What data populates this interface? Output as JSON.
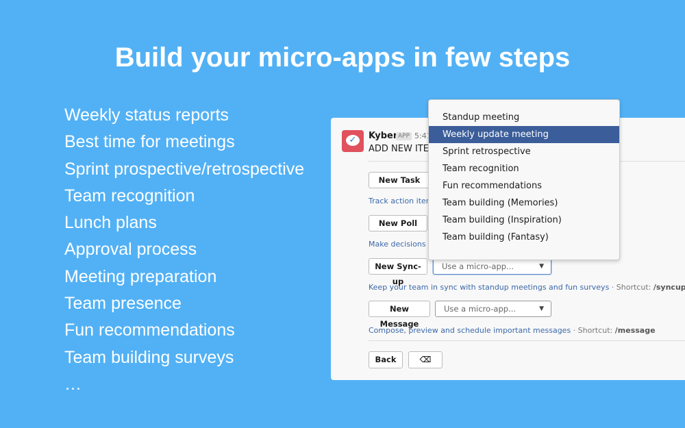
{
  "title": "Build your micro-apps in few steps",
  "features": [
    "Weekly status reports",
    "Best time for meetings",
    "Sprint prospective/retrospective",
    "Team recognition",
    "Lunch plans",
    "Approval process",
    "Meeting preparation",
    "Team presence",
    "Fun recommendations",
    "Team building surveys",
    "…"
  ],
  "message": {
    "app_name": "Kyber",
    "badge": "APP",
    "time": "5:41",
    "heading": "ADD NEW ITEM",
    "avatar_icon": "chat-check-icon",
    "avatar_color": "#e0525d",
    "rows": [
      {
        "button": "New Task",
        "description": "Track action items"
      },
      {
        "button": "New Poll",
        "description": "Make decisions f"
      },
      {
        "button": "New Sync-up",
        "select_placeholder": "Use a micro-app...",
        "description": "Keep your team in sync with standup meetings and fun surveys",
        "shortcut_label": "· Shortcut:",
        "shortcut": "/syncup"
      },
      {
        "button": "New Message",
        "select_placeholder": "Use a micro-app...",
        "description": "Compose, preview and schedule important messages",
        "shortcut_label": "· Shortcut:",
        "shortcut": "/message"
      }
    ],
    "back": "Back",
    "delete_icon": "backspace-icon"
  },
  "dropdown": {
    "options": [
      "Standup meeting",
      "Weekly update meeting",
      "Sprint retrospective",
      "Team recognition",
      "Fun recommendations",
      "Team building (Memories)",
      "Team building (Inspiration)",
      "Team building (Fantasy)"
    ],
    "highlighted": "Weekly update meeting",
    "highlight_color": "#3b5e9a"
  },
  "colors": {
    "background": "#52b1f5",
    "link": "#3a68a8"
  }
}
